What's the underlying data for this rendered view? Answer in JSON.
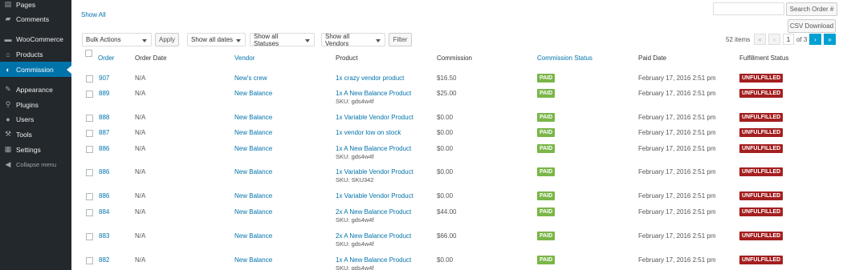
{
  "sidebar": {
    "items": [
      {
        "label": "Pages",
        "icon": "pages-icon"
      },
      {
        "label": "Comments",
        "icon": "comments-icon"
      },
      {
        "label": "WooCommerce",
        "icon": "woocommerce-icon"
      },
      {
        "label": "Products",
        "icon": "products-icon"
      },
      {
        "label": "Commission",
        "icon": "commission-icon"
      },
      {
        "label": "Appearance",
        "icon": "appearance-icon"
      },
      {
        "label": "Plugins",
        "icon": "plugins-icon"
      },
      {
        "label": "Users",
        "icon": "users-icon"
      },
      {
        "label": "Tools",
        "icon": "tools-icon"
      },
      {
        "label": "Settings",
        "icon": "settings-icon"
      },
      {
        "label": "Collapse menu",
        "icon": "collapse-icon"
      }
    ]
  },
  "toolbar": {
    "show_all": "Show All",
    "search_placeholder": "",
    "search_button": "Search Order #",
    "csv_button": "CSV Download",
    "bulk_actions": "Bulk Actions",
    "apply": "Apply",
    "show_dates": "Show all dates",
    "show_statuses": "Show all Statuses",
    "show_vendors": "Show all Vendors",
    "filter": "Filter"
  },
  "pagination": {
    "items_count": "52 items",
    "first": "«",
    "prev": "‹",
    "current": "1",
    "of_label": "of 3",
    "next": "›",
    "last": "»"
  },
  "table": {
    "headers": {
      "order": "Order",
      "order_date": "Order Date",
      "vendor": "Vendor",
      "product": "Product",
      "commission": "Commission",
      "commission_status": "Commission Status",
      "paid_date": "Paid Date",
      "fulfillment_status": "Fulfillment Status"
    },
    "rows": [
      {
        "order": "907",
        "order_date": "N/A",
        "vendor": "New's crew",
        "product": "1x crazy vendor product",
        "sku": "",
        "commission": "$16.50",
        "status": "PAID",
        "paid_date": "February 17, 2016 2:51 pm",
        "fulfillment": "UNFULFILLED"
      },
      {
        "order": "889",
        "order_date": "N/A",
        "vendor": "New Balance",
        "product": "1x A New Balance Product",
        "sku": "SKU: gds4w4f",
        "commission": "$25.00",
        "status": "PAID",
        "paid_date": "February 17, 2016 2:51 pm",
        "fulfillment": "UNFULFILLED"
      },
      {
        "order": "888",
        "order_date": "N/A",
        "vendor": "New Balance",
        "product": "1x Variable Vendor Product",
        "sku": "",
        "commission": "$0.00",
        "status": "PAID",
        "paid_date": "February 17, 2016 2:51 pm",
        "fulfillment": "UNFULFILLED"
      },
      {
        "order": "887",
        "order_date": "N/A",
        "vendor": "New Balance",
        "product": "1x vendor low on stock",
        "sku": "",
        "commission": "$0.00",
        "status": "PAID",
        "paid_date": "February 17, 2016 2:51 pm",
        "fulfillment": "UNFULFILLED"
      },
      {
        "order": "886",
        "order_date": "N/A",
        "vendor": "New Balance",
        "product": "1x A New Balance Product",
        "sku": "SKU: gds4w4f",
        "commission": "$0.00",
        "status": "PAID",
        "paid_date": "February 17, 2016 2:51 pm",
        "fulfillment": "UNFULFILLED"
      },
      {
        "order": "886",
        "order_date": "N/A",
        "vendor": "New Balance",
        "product": "1x Variable Vendor Product",
        "sku": "SKU: SKU342",
        "commission": "$0.00",
        "status": "PAID",
        "paid_date": "February 17, 2016 2:51 pm",
        "fulfillment": "UNFULFILLED"
      },
      {
        "order": "886",
        "order_date": "N/A",
        "vendor": "New Balance",
        "product": "1x Variable Vendor Product",
        "sku": "",
        "commission": "$0.00",
        "status": "PAID",
        "paid_date": "February 17, 2016 2:51 pm",
        "fulfillment": "UNFULFILLED"
      },
      {
        "order": "884",
        "order_date": "N/A",
        "vendor": "New Balance",
        "product": "2x A New Balance Product",
        "sku": "SKU: gds4w4f",
        "commission": "$44.00",
        "status": "PAID",
        "paid_date": "February 17, 2016 2:51 pm",
        "fulfillment": "UNFULFILLED"
      },
      {
        "order": "883",
        "order_date": "N/A",
        "vendor": "New Balance",
        "product": "2x A New Balance Product",
        "sku": "SKU: gds4w4f",
        "commission": "$66.00",
        "status": "PAID",
        "paid_date": "February 17, 2016 2:51 pm",
        "fulfillment": "UNFULFILLED"
      },
      {
        "order": "882",
        "order_date": "N/A",
        "vendor": "New Balance",
        "product": "1x A New Balance Product",
        "sku": "SKU: gds4w4f",
        "commission": "$0.00",
        "status": "PAID",
        "paid_date": "February 17, 2016 2:51 pm",
        "fulfillment": "UNFULFILLED"
      }
    ]
  },
  "colors": {
    "sidebar_bg": "#23282d",
    "active": "#0073aa",
    "link": "#0073aa",
    "paid": "#7ab648",
    "unfulfilled": "#a41f1f"
  }
}
